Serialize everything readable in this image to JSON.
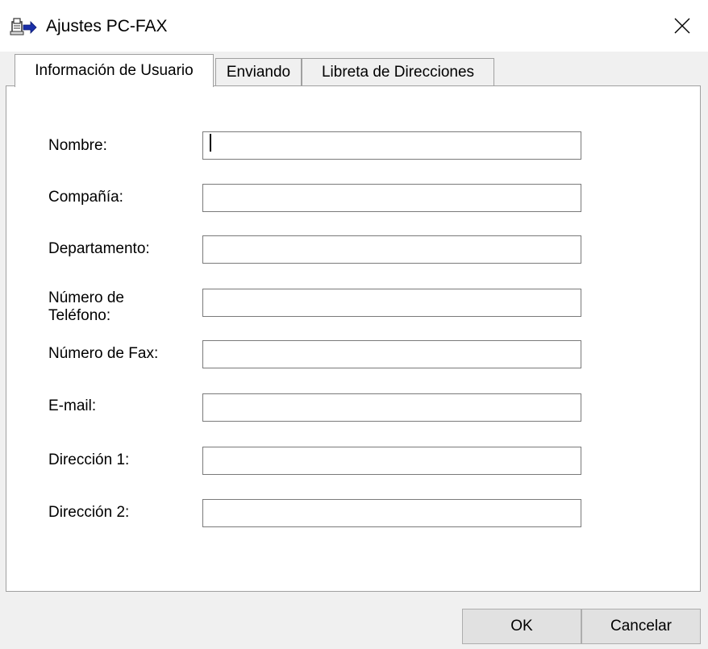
{
  "window": {
    "title": "Ajustes PC-FAX",
    "app_icon": "fax-arrow-icon",
    "close_icon": "close-icon"
  },
  "tabs": [
    {
      "label": "Información de Usuario",
      "active": true
    },
    {
      "label": "Enviando",
      "active": false
    },
    {
      "label": "Libreta de Direcciones",
      "active": false
    }
  ],
  "form": {
    "fields": [
      {
        "label": "Nombre:",
        "value": ""
      },
      {
        "label": "Compañía:",
        "value": ""
      },
      {
        "label": "Departamento:",
        "value": ""
      },
      {
        "label": "Número de Teléfono:",
        "value": ""
      },
      {
        "label": "Número de Fax:",
        "value": ""
      },
      {
        "label": "E-mail:",
        "value": ""
      },
      {
        "label": "Dirección 1:",
        "value": ""
      },
      {
        "label": "Dirección 2:",
        "value": ""
      }
    ]
  },
  "buttons": {
    "ok_label": "OK",
    "cancel_label": "Cancelar"
  }
}
